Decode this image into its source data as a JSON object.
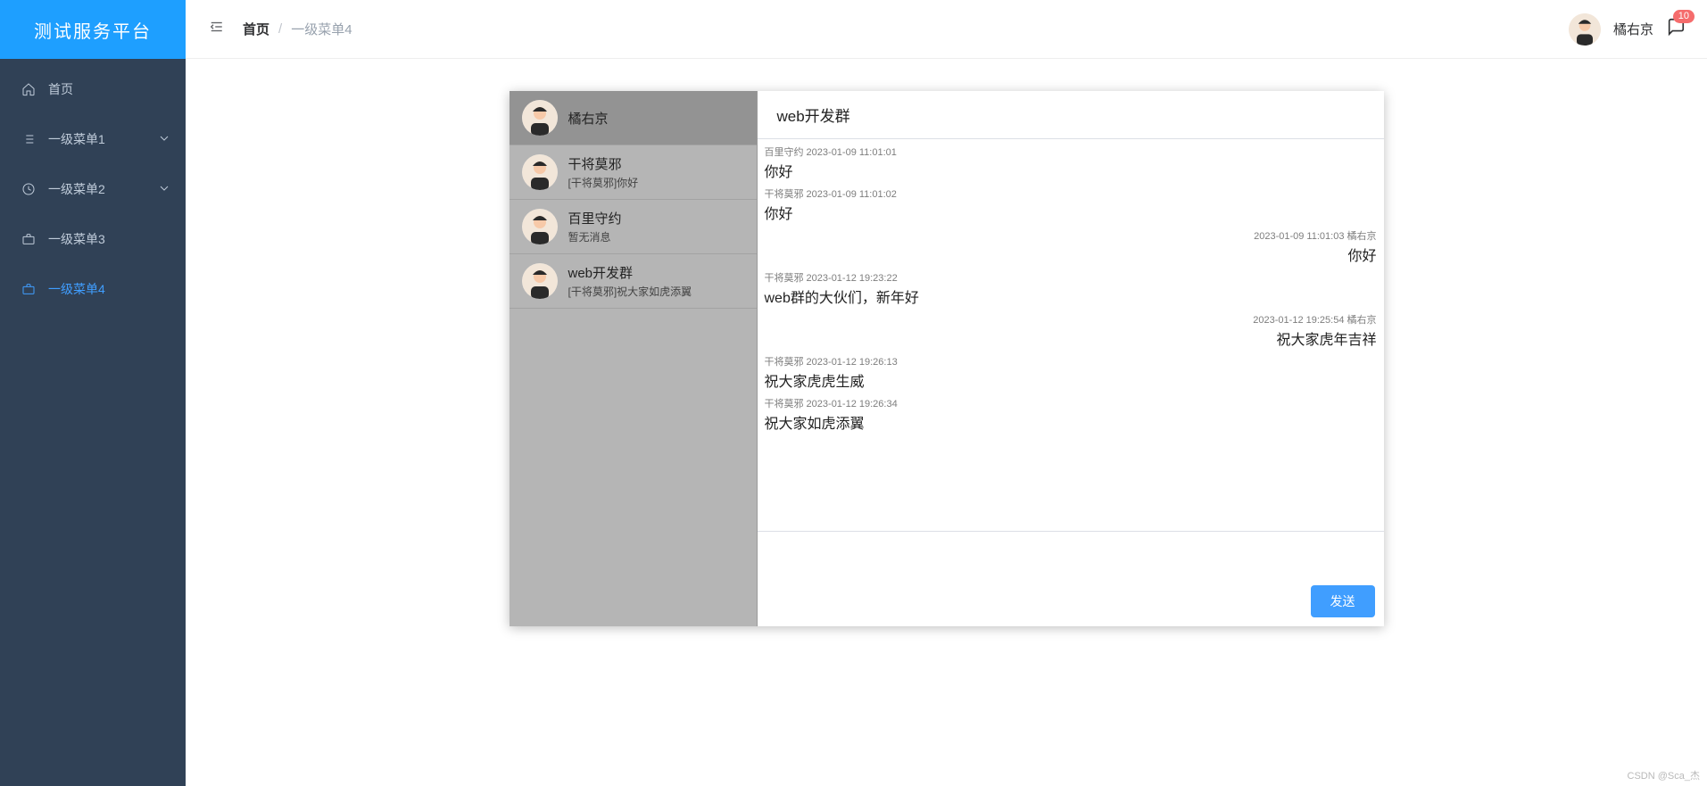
{
  "app": {
    "title": "测试服务平台"
  },
  "sidebar": {
    "items": [
      {
        "label": "首页",
        "icon": "home"
      },
      {
        "label": "一级菜单1",
        "icon": "list",
        "expandable": true
      },
      {
        "label": "一级菜单2",
        "icon": "clock",
        "expandable": true
      },
      {
        "label": "一级菜单3",
        "icon": "briefcase"
      },
      {
        "label": "一级菜单4",
        "icon": "briefcase",
        "active": true
      }
    ]
  },
  "header": {
    "breadcrumb_root": "首页",
    "breadcrumb_sep": "/",
    "breadcrumb_current": "一级菜单4",
    "username": "橘右京",
    "badge_count": "10"
  },
  "chat": {
    "contacts": [
      {
        "name": "橘右京",
        "preview": "",
        "selected": true
      },
      {
        "name": "干将莫邪",
        "preview": "[干将莫邪]你好"
      },
      {
        "name": "百里守约",
        "preview": "暂无消息"
      },
      {
        "name": "web开发群",
        "preview": "[干将莫邪]祝大家如虎添翼"
      }
    ],
    "active_title": "web开发群",
    "messages": [
      {
        "side": "left",
        "sender": "百里守约",
        "time": "2023-01-09 11:01:01",
        "text": "你好"
      },
      {
        "side": "left",
        "sender": "干将莫邪",
        "time": "2023-01-09 11:01:02",
        "text": "你好"
      },
      {
        "side": "right",
        "sender": "橘右京",
        "time": "2023-01-09 11:01:03",
        "text": "你好"
      },
      {
        "side": "left",
        "sender": "干将莫邪",
        "time": "2023-01-12 19:23:22",
        "text": "web群的大伙们，新年好"
      },
      {
        "side": "right",
        "sender": "橘右京",
        "time": "2023-01-12 19:25:54",
        "text": "祝大家虎年吉祥"
      },
      {
        "side": "left",
        "sender": "干将莫邪",
        "time": "2023-01-12 19:26:13",
        "text": "祝大家虎虎生威"
      },
      {
        "side": "left",
        "sender": "干将莫邪",
        "time": "2023-01-12 19:26:34",
        "text": "祝大家如虎添翼"
      }
    ],
    "send_label": "发送",
    "compose_placeholder": ""
  },
  "watermark": "CSDN @Sca_杰"
}
